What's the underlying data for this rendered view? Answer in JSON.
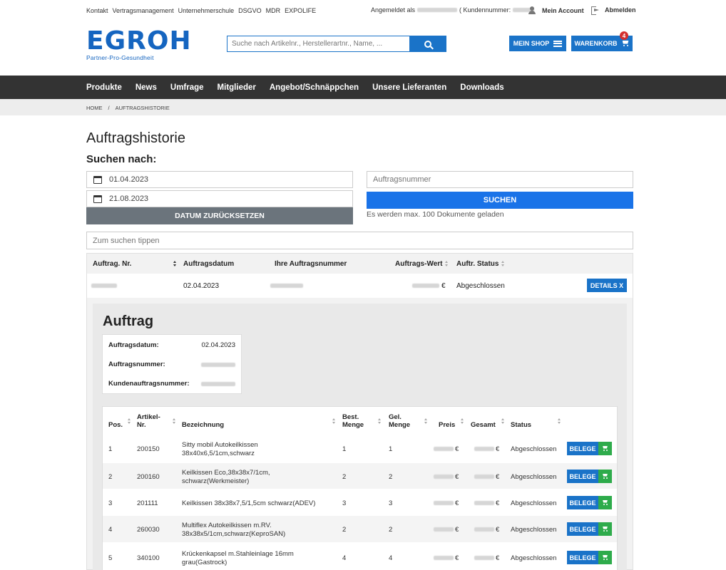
{
  "top": {
    "links": [
      "Kontakt",
      "Vertragsmanagement",
      "Unternehmerschule",
      "DSGVO",
      "MDR",
      "EXPOLIFE"
    ],
    "logged_in_prefix": "Angemeldet als",
    "customer_label": "( Kundennummer:",
    "account_label": "Mein Account",
    "logout_label": "Abmelden"
  },
  "brand": {
    "logo_text": "EGROH",
    "logo_sub": "Partner-Pro-Gesundheit",
    "brand_color": "#1565c0"
  },
  "header": {
    "search_placeholder": "Suche nach Artikelnr., Herstellerartnr., Name, ...",
    "shop_label": "MEIN SHOP",
    "cart_label": "WARENKORB",
    "cart_count": "4"
  },
  "nav": {
    "items": [
      "Produkte",
      "News",
      "Umfrage",
      "Mitglieder",
      "Angebot/Schnäppchen",
      "Unsere Lieferanten",
      "Downloads"
    ]
  },
  "breadcrumb": {
    "home": "HOME",
    "sep": "/",
    "current": "AUFTRAGSHISTORIE"
  },
  "page": {
    "title": "Auftragshistorie",
    "search_heading": "Suchen nach:",
    "date_from": "01.04.2023",
    "date_to": "21.08.2023",
    "reset_label": "DATUM ZURÜCKSETZEN",
    "order_placeholder": "Auftragsnummer",
    "search_label": "SUCHEN",
    "hint": "Es werden max. 100 Dokumente geladen",
    "filter_placeholder": "Zum suchen tippen"
  },
  "orders": {
    "headers": [
      "Auftrag. Nr.",
      "Auftragsdatum",
      "Ihre Auftragsnummer",
      "Auftrags-Wert",
      "Auftr. Status"
    ],
    "row": {
      "date": "02.04.2023",
      "currency": "€",
      "status": "Abgeschlossen",
      "details_label": "DETAILS X"
    }
  },
  "detail": {
    "title": "Auftrag",
    "info": [
      {
        "label": "Auftragsdatum:",
        "value": "02.04.2023"
      },
      {
        "label": "Auftragsnummer:",
        "value": ""
      },
      {
        "label": "Kundenauftragsnummer:",
        "value": ""
      }
    ],
    "item_headers": {
      "pos": "Pos.",
      "artikel_1": "Artikel-",
      "artikel_2": "Nr.",
      "bezeichnung": "Bezeichnung",
      "best_1": "Best.",
      "best_2": "Menge",
      "gel_1": "Gel.",
      "gel_2": "Menge",
      "preis": "Preis",
      "gesamt": "Gesamt",
      "status": "Status"
    },
    "items": [
      {
        "pos": "1",
        "nr": "200150",
        "name_1": "Sitty mobil Autokeilkissen",
        "name_2": "38x40x6,5/1cm,schwarz",
        "best": "1",
        "gel": "1",
        "currency": "€",
        "status": "Abgeschlossen",
        "belege": "BELEGE"
      },
      {
        "pos": "2",
        "nr": "200160",
        "name_1": "Keilkissen Eco,38x38x7/1cm,",
        "name_2": "schwarz(Werkmeister)",
        "best": "2",
        "gel": "2",
        "currency": "€",
        "status": "Abgeschlossen",
        "belege": "BELEGE"
      },
      {
        "pos": "3",
        "nr": "201111",
        "name_1": "Keilkissen 38x38x7,5/1,5cm schwarz(ADEV)",
        "name_2": "",
        "best": "3",
        "gel": "3",
        "currency": "€",
        "status": "Abgeschlossen",
        "belege": "BELEGE"
      },
      {
        "pos": "4",
        "nr": "260030",
        "name_1": "Multiflex Autokeilkissen m.RV.",
        "name_2": "38x38x5/1cm,schwarz(KeproSAN)",
        "best": "2",
        "gel": "2",
        "currency": "€",
        "status": "Abgeschlossen",
        "belege": "BELEGE"
      },
      {
        "pos": "5",
        "nr": "340100",
        "name_1": "Krückenkapsel m.Stahleinlage 16mm",
        "name_2": "grau(Gastrock)",
        "best": "4",
        "gel": "4",
        "currency": "€",
        "status": "Abgeschlossen",
        "belege": "BELEGE"
      }
    ]
  }
}
